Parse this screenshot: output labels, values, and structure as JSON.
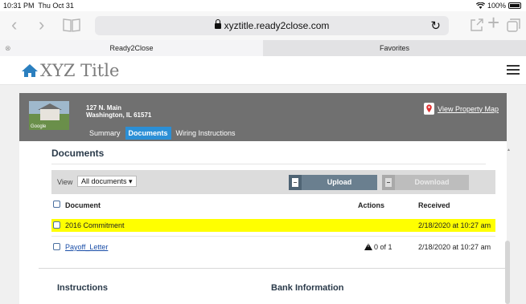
{
  "status_bar": {
    "time": "10:31 PM",
    "date": "Thu Oct 31",
    "battery": "100%"
  },
  "browser": {
    "url": "xyztitle.ready2close.com",
    "tabs": [
      {
        "label": "Ready2Close",
        "active": true
      },
      {
        "label": "Favorites",
        "active": false
      }
    ]
  },
  "site": {
    "logo_text": "XYZ Title",
    "brand_color": "#2b7fbf"
  },
  "property": {
    "street": "127 N. Main",
    "city_state_zip": "Washington, IL 61571",
    "thumbnail_caption": "Google",
    "tabs": [
      {
        "label": "Summary",
        "active": false
      },
      {
        "label": "Documents",
        "active": true
      },
      {
        "label": "Wiring Instructions",
        "active": false
      }
    ],
    "map_link": "View Property Map"
  },
  "documents": {
    "title": "Documents",
    "view_label": "View",
    "view_selected": "All documents",
    "upload_label": "Upload",
    "download_label": "Download",
    "columns": {
      "document": "Document",
      "actions": "Actions",
      "received": "Received"
    },
    "rows": [
      {
        "name": "2016 Commitment",
        "actions": "",
        "received": "2/18/2020 at 10:27 am",
        "highlighted": true
      },
      {
        "name": "Payoff_Letter",
        "actions": "0 of 1",
        "received": "2/18/2020 at 10:27 am",
        "highlighted": false
      }
    ]
  },
  "sections": {
    "instructions": "Instructions",
    "bank_information": "Bank Information"
  }
}
